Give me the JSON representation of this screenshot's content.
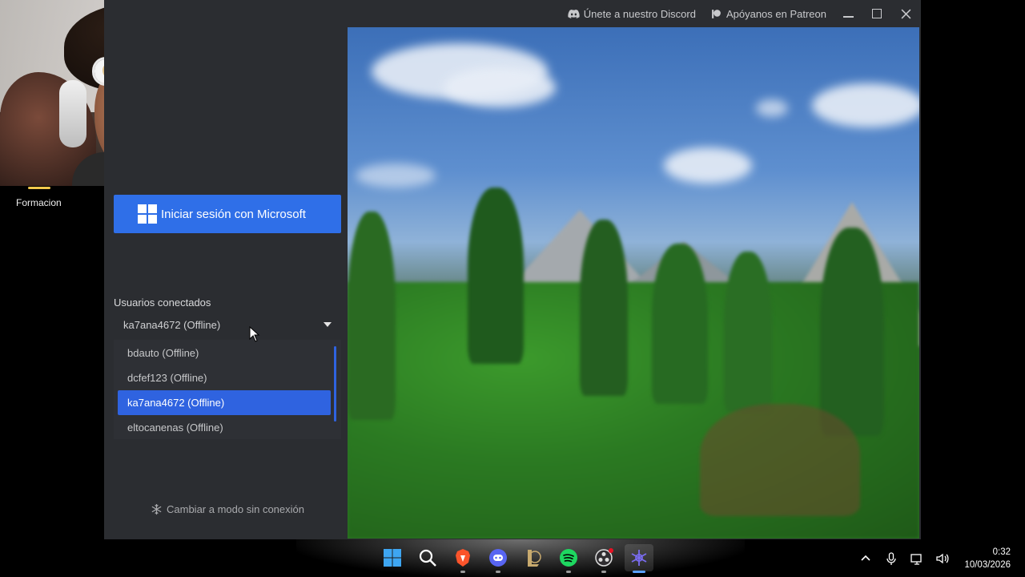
{
  "webcam": {
    "label": "Formacion"
  },
  "titlebar": {
    "discord_link": "Únete a nuestro Discord",
    "patreon_link": "Apóyanos en Patreon"
  },
  "login": {
    "button_label": "Iniciar sesión con Microsoft"
  },
  "accounts": {
    "label": "Usuarios conectados",
    "selected": "ka7ana4672 (Offline)",
    "options": [
      {
        "label": "bdauto (Offline)"
      },
      {
        "label": "dcfef123 (Offline)"
      },
      {
        "label": "ka7ana4672 (Offline)"
      },
      {
        "label": "eltocanenas (Offline)"
      }
    ]
  },
  "offline_mode": {
    "label": "Cambiar a modo sin conexión"
  },
  "taskbar": {
    "apps": [
      "start-icon",
      "search-icon",
      "brave-icon",
      "discord-icon",
      "league-icon",
      "spotify-icon",
      "obs-icon",
      "launcher-icon"
    ],
    "clock_time": "0:32",
    "clock_date": "10/03/2026"
  },
  "colors": {
    "accent": "#2f6fe8",
    "window_bg": "#2b2d31",
    "selected_option": "#2f63e0"
  }
}
